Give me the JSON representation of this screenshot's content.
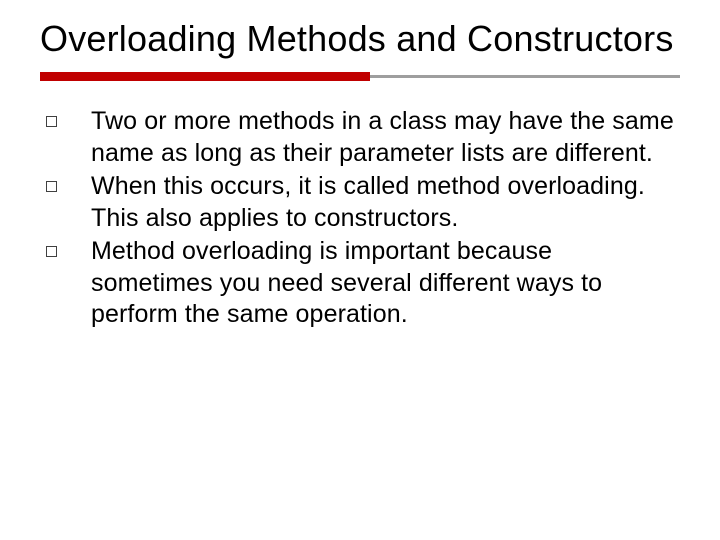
{
  "title": "Overloading Methods and Constructors",
  "bullets": [
    "Two or more methods in a class may have the same name as long as their parameter lists are different.",
    "When this occurs, it is called method overloading.  This also applies to constructors.",
    "Method overloading is important because sometimes you need several different ways to perform the same operation."
  ],
  "colors": {
    "accent": "#c00000",
    "rule_grey": "#9e9e9e"
  }
}
